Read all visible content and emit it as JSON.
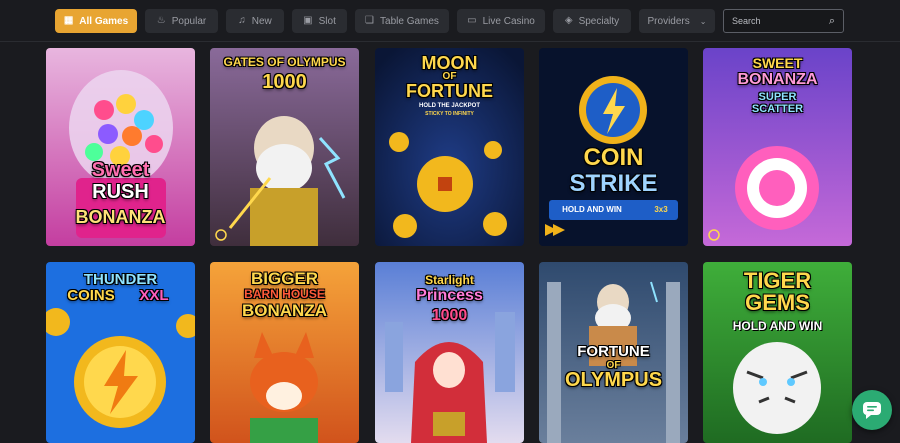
{
  "filters": {
    "tabs": [
      {
        "label": "All Games",
        "icon": "grid-icon"
      },
      {
        "label": "Popular",
        "icon": "flame-icon"
      },
      {
        "label": "New",
        "icon": "bell-icon"
      },
      {
        "label": "Slot",
        "icon": "slot-icon"
      },
      {
        "label": "Table Games",
        "icon": "cards-icon"
      },
      {
        "label": "Live Casino",
        "icon": "monitor-icon"
      },
      {
        "label": "Specialty",
        "icon": "tag-icon"
      },
      {
        "label": "Providers",
        "icon": "chevron-down-icon"
      }
    ],
    "active_tab": "All Games"
  },
  "search": {
    "placeholder": "Search",
    "icon": "search-icon"
  },
  "games": [
    {
      "line1": "Sweet",
      "line2": "RUSH",
      "line3": "BONANZA"
    },
    {
      "line1": "GATES OF OLYMPUS",
      "line2": "1000"
    },
    {
      "line1": "MOON",
      "line2": "OF",
      "line3": "FORTUNE",
      "sub1": "HOLD THE JACKPOT",
      "sub2": "STICKY TO INFINITY"
    },
    {
      "line1": "COIN",
      "line2": "STRIKE",
      "sub1": "HOLD AND WIN",
      "sub2": "3x3"
    },
    {
      "line1": "SWEET",
      "line2": "BONANZA",
      "line3": "SUPER",
      "line4": "SCATTER"
    },
    {
      "line1": "THUNDER",
      "line2": "COINS",
      "line3": "XXL"
    },
    {
      "line1": "BIGGER",
      "line2": "BARN HOUSE",
      "line3": "BONANZA"
    },
    {
      "line1": "Starlight",
      "line2": "Princess",
      "line3": "1000"
    },
    {
      "line1": "FORTUNE",
      "line2": "OF",
      "line3": "OLYMPUS"
    },
    {
      "line1": "TIGER",
      "line2": "GEMS",
      "sub1": "HOLD AND WIN"
    }
  ],
  "chat": {
    "icon": "chat-icon"
  },
  "colors": {
    "accent": "#e8a532",
    "background": "#1a1b1f",
    "tab_bg": "#2a2c31",
    "chat": "#2bab73"
  }
}
